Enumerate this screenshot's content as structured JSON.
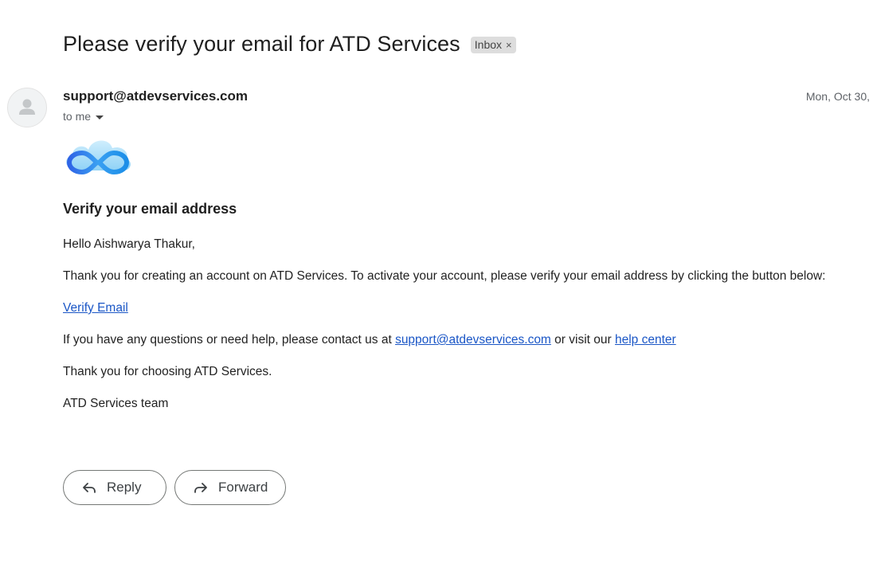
{
  "email": {
    "subject": "Please verify your email for ATD Services",
    "label": {
      "text": "Inbox",
      "close_glyph": "×"
    },
    "sender": "support@atdevservices.com",
    "date": "Mon, Oct 30,",
    "recipient": "to me",
    "avatar_icon": "person-icon",
    "logo_icon": "infinity-cloud-logo"
  },
  "body": {
    "heading": "Verify your email address",
    "greeting": "Hello Aishwarya Thakur,",
    "intro": "Thank you for creating an account on ATD Services. To activate your account, please verify your email address by clicking the button below:",
    "verify_link": "Verify Email",
    "help_prefix": "If you have any questions or need help, please contact us at ",
    "help_email": "support@atdevservices.com",
    "help_middle": " or visit our ",
    "help_center": "help center",
    "thanks": "Thank you for choosing ATD Services.",
    "signature": "ATD Services team"
  },
  "actions": {
    "reply_label": "Reply",
    "reply_icon": "reply-icon",
    "forward_label": "Forward",
    "forward_icon": "forward-icon"
  },
  "colors": {
    "link": "#1a56c6",
    "chip_bg": "#dddddd",
    "secondary_text": "#5f6368"
  }
}
